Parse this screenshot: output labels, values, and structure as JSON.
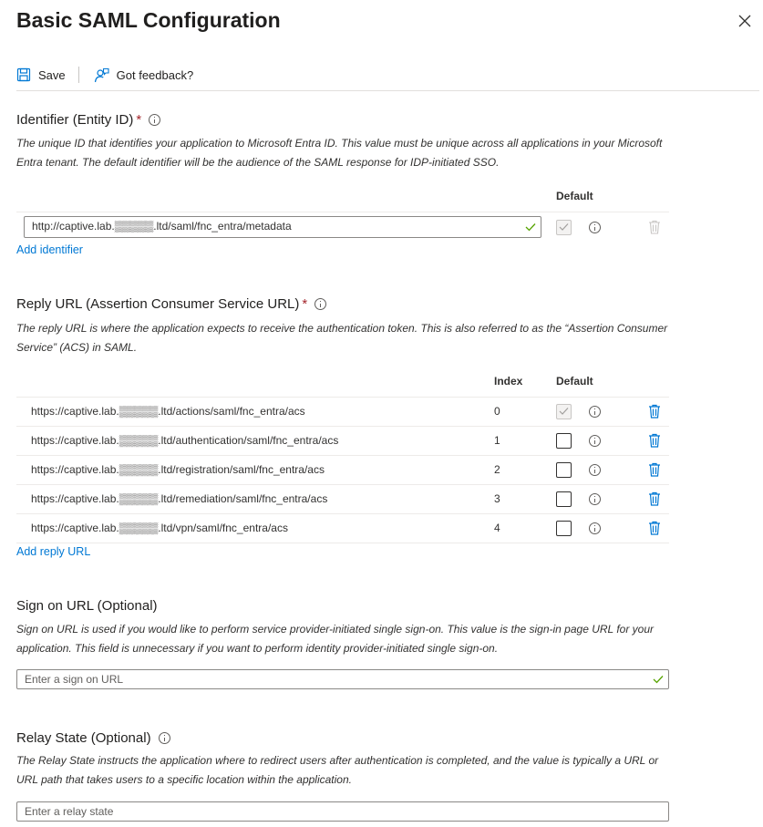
{
  "header": {
    "title": "Basic SAML Configuration"
  },
  "toolbar": {
    "save_label": "Save",
    "feedback_label": "Got feedback?"
  },
  "identifier": {
    "title": "Identifier (Entity ID)",
    "required": "*",
    "description": "The unique ID that identifies your application to Microsoft Entra ID. This value must be unique across all applications in your Microsoft Entra tenant. The default identifier will be the audience of the SAML response for IDP-initiated SSO.",
    "default_header": "Default",
    "value": "http://captive.lab.▒▒▒▒▒.ltd/saml/fnc_entra/metadata",
    "add_label": "Add identifier"
  },
  "reply": {
    "title": "Reply URL (Assertion Consumer Service URL)",
    "required": "*",
    "description": "The reply URL is where the application expects to receive the authentication token. This is also referred to as the “Assertion Consumer Service” (ACS) in SAML.",
    "index_header": "Index",
    "default_header": "Default",
    "rows": [
      {
        "url": "https://captive.lab.▒▒▒▒▒.ltd/actions/saml/fnc_entra/acs",
        "index": "0",
        "default": true
      },
      {
        "url": "https://captive.lab.▒▒▒▒▒.ltd/authentication/saml/fnc_entra/acs",
        "index": "1",
        "default": false
      },
      {
        "url": "https://captive.lab.▒▒▒▒▒.ltd/registration/saml/fnc_entra/acs",
        "index": "2",
        "default": false
      },
      {
        "url": "https://captive.lab.▒▒▒▒▒.ltd/remediation/saml/fnc_entra/acs",
        "index": "3",
        "default": false
      },
      {
        "url": "https://captive.lab.▒▒▒▒▒.ltd/vpn/saml/fnc_entra/acs",
        "index": "4",
        "default": false
      }
    ],
    "add_label": "Add reply URL"
  },
  "signon": {
    "title": "Sign on URL (Optional)",
    "description": "Sign on URL is used if you would like to perform service provider-initiated single sign-on. This value is the sign-in page URL for your application. This field is unnecessary if you want to perform identity provider-initiated single sign-on.",
    "placeholder": "Enter a sign on URL"
  },
  "relay": {
    "title": "Relay State (Optional)",
    "description": "The Relay State instructs the application where to redirect users after authentication is completed, and the value is typically a URL or URL path that takes users to a specific location within the application.",
    "placeholder": "Enter a relay state"
  },
  "colors": {
    "link": "#0078d4",
    "check": "#57a300",
    "required": "#a4262c"
  }
}
